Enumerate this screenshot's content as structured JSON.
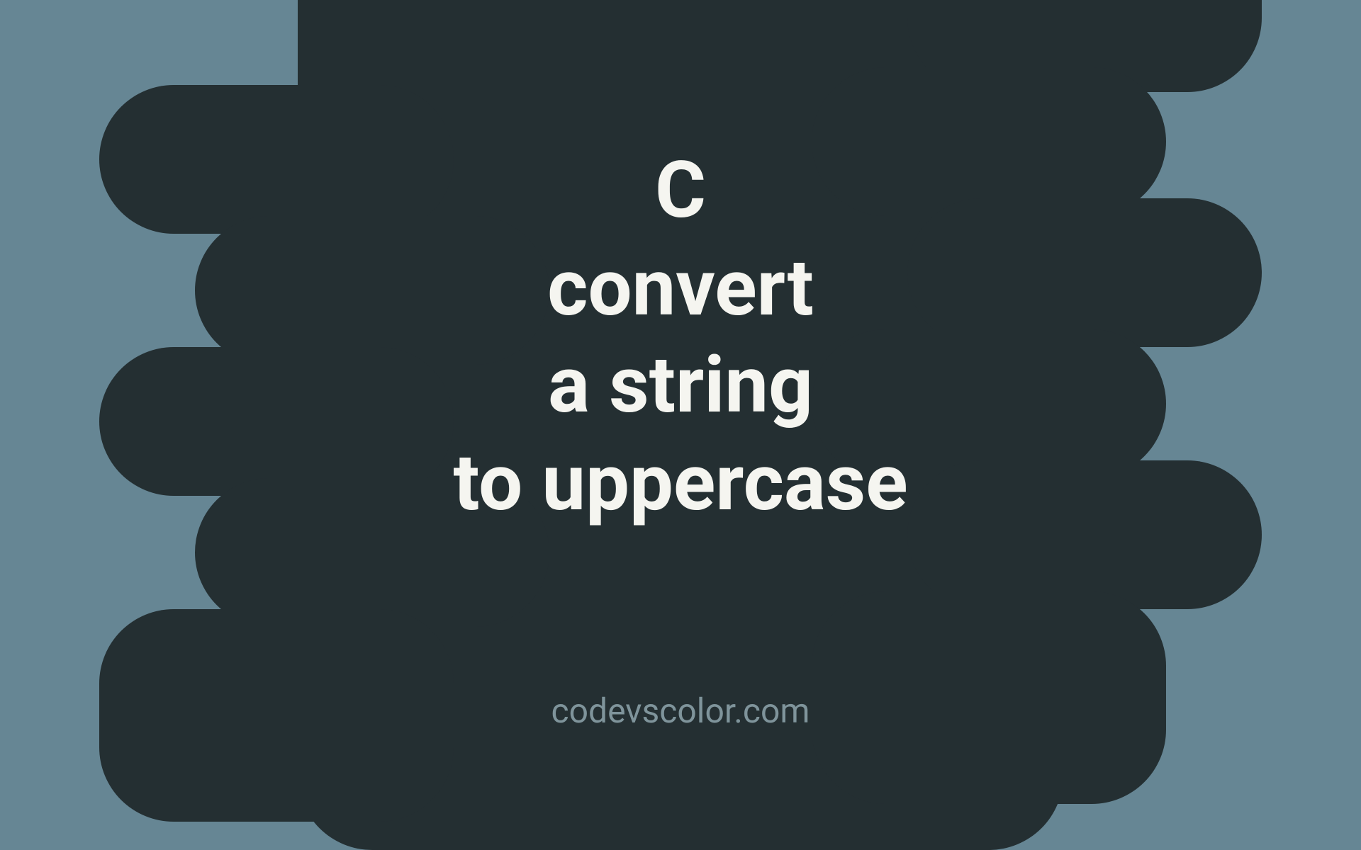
{
  "title": {
    "line1": "C",
    "line2": "convert",
    "line3": "a string",
    "line4": "to uppercase"
  },
  "watermark": "codevscolor.com",
  "colors": {
    "background": "#668694",
    "blob": "#242f32",
    "text": "#f5f5f0",
    "watermark": "#7f949b"
  }
}
